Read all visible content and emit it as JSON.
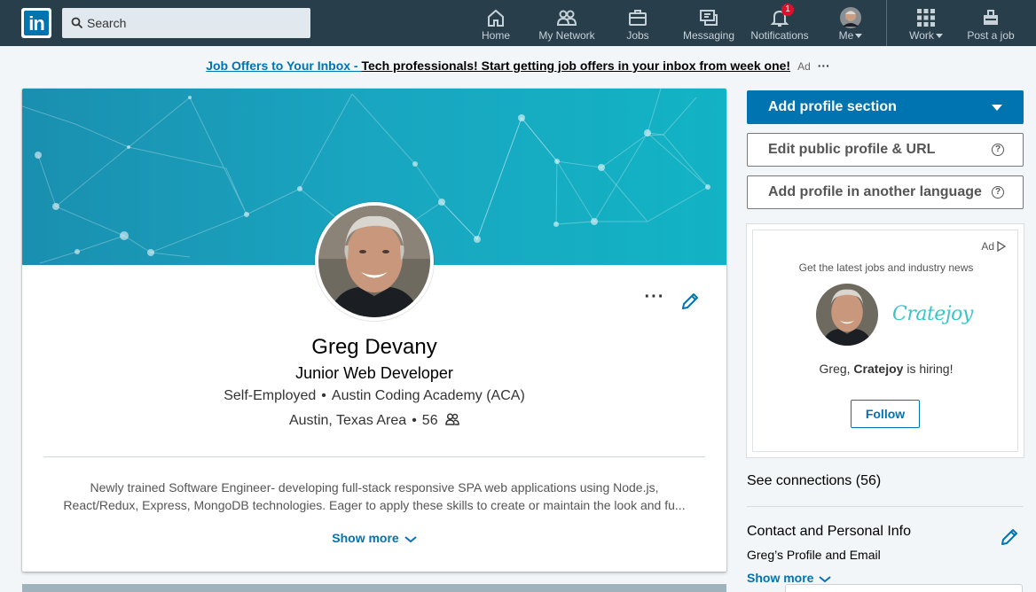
{
  "nav": {
    "logo_text": "in",
    "search_placeholder": "Search",
    "items": [
      {
        "label": "Home",
        "icon": "home-icon"
      },
      {
        "label": "My Network",
        "icon": "network-icon"
      },
      {
        "label": "Jobs",
        "icon": "briefcase-icon"
      },
      {
        "label": "Messaging",
        "icon": "messaging-icon"
      },
      {
        "label": "Notifications",
        "icon": "bell-icon",
        "badge": "1"
      },
      {
        "label": "Me",
        "icon": "avatar"
      },
      {
        "label": "Work",
        "icon": "grid-icon"
      },
      {
        "label": "Post a job",
        "icon": "post-job-icon"
      }
    ]
  },
  "ad_bar": {
    "link": "Job Offers to Your Inbox - ",
    "text": "Tech professionals! Start getting job offers in your inbox from week one!",
    "tag": "Ad",
    "more": "···"
  },
  "profile": {
    "name": "Greg Devany",
    "headline": "Junior Web Developer",
    "company": "Self-Employed",
    "school": "Austin Coding Academy (ACA)",
    "location": "Austin, Texas Area",
    "connections": "56",
    "separator": "•",
    "summary_line1": "Newly trained Software Engineer- developing full-stack responsive SPA web applications using Node.js,",
    "summary_line2": "React/Redux, Express, MongoDB technologies. Eager to apply these skills to create or maintain the look and fu...",
    "show_more": "Show more",
    "more_actions": "···"
  },
  "rail": {
    "add_section": "Add profile section",
    "edit_public": "Edit public profile & URL",
    "add_language": "Add profile in another language",
    "help_glyph": "?",
    "ad": {
      "label": "Ad",
      "headline": "Get the latest jobs and industry news",
      "brand": "Cratejoy",
      "hiring_prefix": "Greg, ",
      "hiring_company": "Cratejoy",
      "hiring_suffix": " is hiring!",
      "follow": "Follow"
    },
    "see_connections": "See connections (56)",
    "contact_title": "Contact and Personal Info",
    "contact_sub": "Greg’s Profile and Email",
    "contact_more": "Show more"
  },
  "colors": {
    "nav_bg": "#283e4a",
    "brand_blue": "#0073b1",
    "banner": "#19a6c0",
    "badge_red": "#e0102c"
  }
}
